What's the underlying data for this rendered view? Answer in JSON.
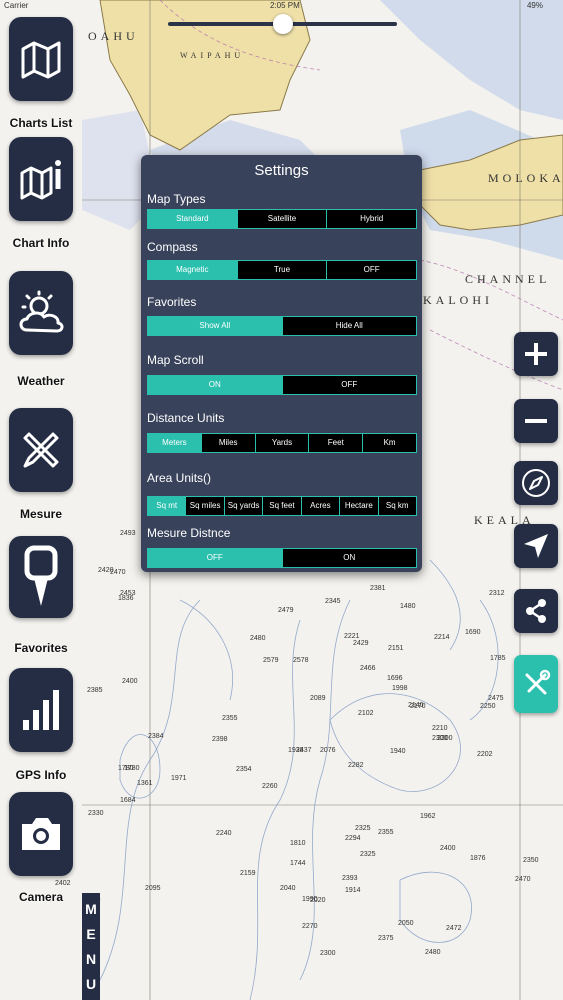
{
  "status_bar": {
    "carrier": "Carrier",
    "time": "2:05 PM",
    "battery": "49%"
  },
  "sidebar": {
    "items": [
      {
        "label": "Charts List",
        "icon": "map-icon"
      },
      {
        "label": "Chart Info",
        "icon": "map-info-icon"
      },
      {
        "label": "Weather",
        "icon": "weather-icon"
      },
      {
        "label": "Mesure",
        "icon": "ruler-pencil-icon"
      },
      {
        "label": "Favorites",
        "icon": "pin-icon"
      },
      {
        "label": "GPS Info",
        "icon": "signal-bars-icon"
      },
      {
        "label": "Camera",
        "icon": "camera-icon"
      }
    ],
    "menu_tab": [
      "M",
      "E",
      "N",
      "U"
    ]
  },
  "right_controls": [
    "zoom-in-icon",
    "zoom-out-icon",
    "compass-icon",
    "locate-arrow-icon",
    "share-icon",
    "tools-icon"
  ],
  "settings": {
    "title": "Settings",
    "sections": [
      {
        "label": "Map Types",
        "options": [
          "Standard",
          "Satellite",
          "Hybrid"
        ],
        "selected": 0
      },
      {
        "label": "Compass",
        "options": [
          "Magnetic",
          "True",
          "OFF"
        ],
        "selected": 0
      },
      {
        "label": "Favorites",
        "options": [
          "Show All",
          "Hide All"
        ],
        "selected": 0
      },
      {
        "label": "Map Scroll",
        "options": [
          "ON",
          "OFF"
        ],
        "selected": 0
      },
      {
        "label": "Distance Units",
        "options": [
          "Meters",
          "Miles",
          "Yards",
          "Feet",
          "Km"
        ],
        "selected": 0
      },
      {
        "label": "Area Units()",
        "options": [
          "Sq mt",
          "Sq miles",
          "Sq yards",
          "Sq feet",
          "Acres",
          "Hectare",
          "Sq km"
        ],
        "selected": 0
      },
      {
        "label": "Mesure Distnce",
        "options": [
          "OFF",
          "ON"
        ],
        "selected": 0
      }
    ]
  },
  "map": {
    "place_labels": [
      "OAHU",
      "WAIPAHU",
      "CHANNEL",
      "KALOHI",
      "KEALA",
      "MOLOKAI"
    ],
    "depths": [
      "2355",
      "2240",
      "2381",
      "1836",
      "2480",
      "2345",
      "2040",
      "2393",
      "2300",
      "1962",
      "2159",
      "2170",
      "2095",
      "2020",
      "1780",
      "1361",
      "1971",
      "1684",
      "2089",
      "1938",
      "2076",
      "2202",
      "2210",
      "2325",
      "2294",
      "2355",
      "1998",
      "1696",
      "2260",
      "1990",
      "2325",
      "1876",
      "1744",
      "1810",
      "1914",
      "2480",
      "2470",
      "2479",
      "2578",
      "2579",
      "2453",
      "2420",
      "2493",
      "2437",
      "2466",
      "2429",
      "2385",
      "2400",
      "1780",
      "2384",
      "2398",
      "2354",
      "2102",
      "2282",
      "2221",
      "2151",
      "2214",
      "2312",
      "2050",
      "2472",
      "2270",
      "1480",
      "1690",
      "1785",
      "1940",
      "2300",
      "2140",
      "2250",
      "2400",
      "2350",
      "2470",
      "2530",
      "2475",
      "2402",
      "2319",
      "2375",
      "2300",
      "2330"
    ]
  },
  "colors": {
    "panel": "#39425b",
    "accent": "#2bbfae",
    "tile": "#252d45",
    "land": "#efe0a8",
    "shoal": "#b9c9e6",
    "sea": "#f3f2ee"
  }
}
